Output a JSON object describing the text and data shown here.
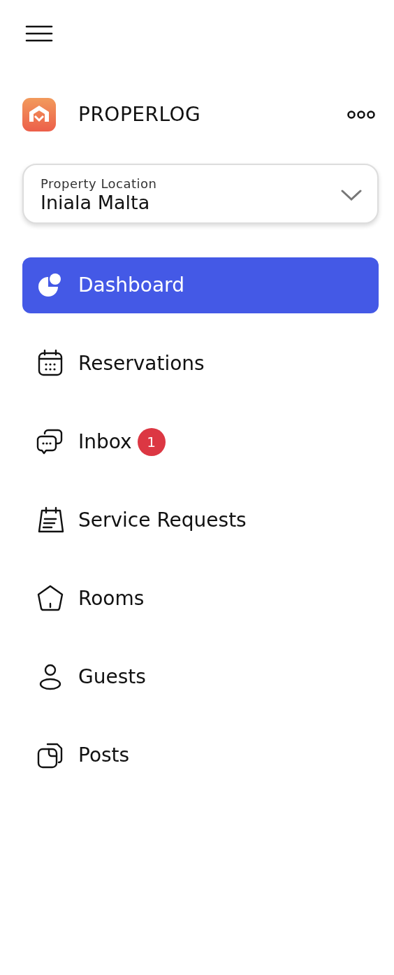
{
  "brand": {
    "name": "PROPERLOG"
  },
  "location": {
    "label": "Property Location",
    "value": "Iniala Malta"
  },
  "nav": [
    {
      "label": "Dashboard",
      "selected": true
    },
    {
      "label": "Reservations",
      "selected": false
    },
    {
      "label": "Inbox",
      "selected": false,
      "badge": "1"
    },
    {
      "label": "Service Requests",
      "selected": false
    },
    {
      "label": "Rooms",
      "selected": false
    },
    {
      "label": "Guests",
      "selected": false
    },
    {
      "label": "Posts",
      "selected": false
    }
  ]
}
